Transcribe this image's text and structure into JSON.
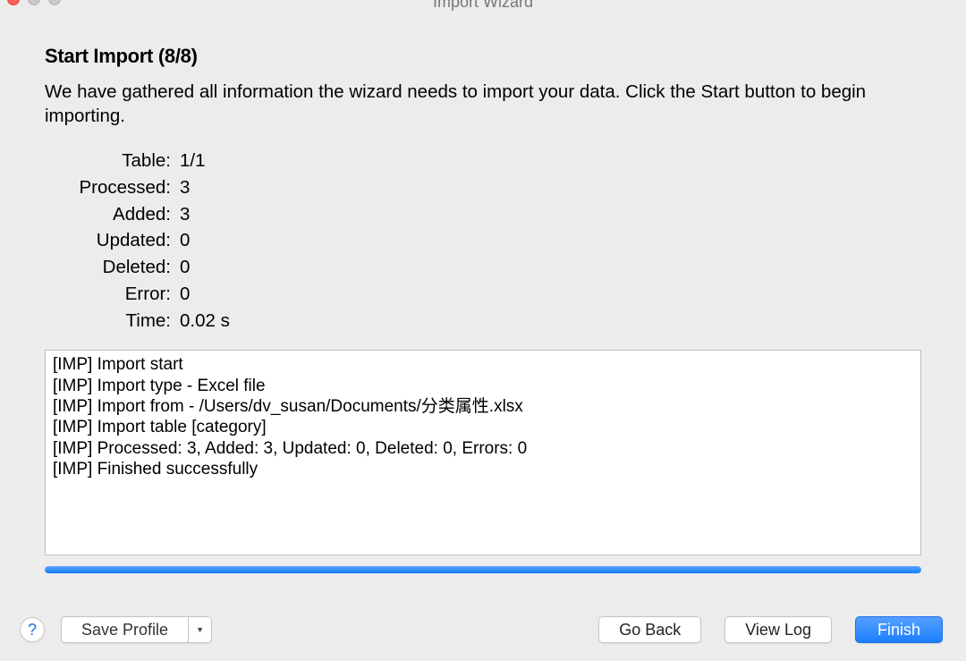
{
  "window": {
    "title": "Import Wizard"
  },
  "page": {
    "heading": "Start Import (8/8)",
    "description": "We have gathered all information the wizard needs to import your data. Click the Start button to begin importing."
  },
  "stats": {
    "table_label": "Table:",
    "table_value": "1/1",
    "processed_label": "Processed:",
    "processed_value": "3",
    "added_label": "Added:",
    "added_value": "3",
    "updated_label": "Updated:",
    "updated_value": "0",
    "deleted_label": "Deleted:",
    "deleted_value": "0",
    "error_label": "Error:",
    "error_value": "0",
    "time_label": "Time:",
    "time_value": "0.02 s"
  },
  "log": {
    "lines": [
      "[IMP] Import start",
      "[IMP] Import type - Excel file",
      "[IMP] Import from - /Users/dv_susan/Documents/分类属性.xlsx",
      "[IMP] Import table [category]",
      "[IMP] Processed: 3, Added: 3, Updated: 0, Deleted: 0, Errors: 0",
      "[IMP] Finished successfully"
    ]
  },
  "progress": {
    "percent": 100
  },
  "footer": {
    "help_label": "?",
    "save_profile_label": "Save Profile",
    "go_back_label": "Go Back",
    "view_log_label": "View Log",
    "finish_label": "Finish"
  }
}
